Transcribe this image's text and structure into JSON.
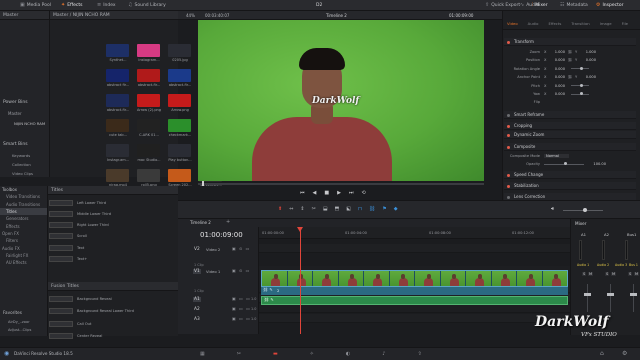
{
  "topbar": {
    "media_pool": "Media Pool",
    "effects": "Effects",
    "index": "Index",
    "sound_library": "Sound Library",
    "project_title": "D2",
    "quick_export": "Quick Export",
    "audio": "Audio",
    "mixer": "Mixer",
    "metadata": "Metadata",
    "inspector": "Inspector"
  },
  "media": {
    "master_label": "Master",
    "breadcrumb": "Master / NIJIN NCHO RAM",
    "thumbs": [
      {
        "label": "Synthet...",
        "color": "#1d2f66"
      },
      {
        "label": "Instagram...",
        "color": "#d63a83"
      },
      {
        "label": "0205.jpg",
        "color": "#2a2c34"
      },
      {
        "label": "240839.jpg",
        "color": "#1f2c6b"
      },
      {
        "label": "abstract fir...",
        "color": "#15246a"
      },
      {
        "label": "abstract-fir...",
        "color": "#b01a1a"
      },
      {
        "label": "abstract-fir...",
        "color": "#1b3a8a"
      },
      {
        "label": "abstract-fir...",
        "color": "#152a66"
      },
      {
        "label": "abstract-fir...",
        "color": "#1d2a58"
      },
      {
        "label": "Arrow (2).png",
        "color": "#c51b1b"
      },
      {
        "label": "Arrow.png",
        "color": "#c51b1b"
      },
      {
        "label": "Audio.00101...",
        "color": "#1c3a1c"
      },
      {
        "label": "cute tab...",
        "color": "#3b2a1a"
      },
      {
        "label": "C-ARK 01...",
        "color": "#222"
      },
      {
        "label": "checkmark...",
        "color": "#2b8f2b"
      },
      {
        "label": "grunge-be...",
        "color": "#4a4a4a"
      },
      {
        "label": "Instagr.am...",
        "color": "#2a2c34"
      },
      {
        "label": "mac Studio...",
        "color": "#202020"
      },
      {
        "label": "Play button...",
        "color": "#2a2c34"
      },
      {
        "label": "Play button...",
        "color": "#1d3d7a"
      },
      {
        "label": "nirag.mp4",
        "color": "#4a3a2a"
      },
      {
        "label": "roll5.png",
        "color": "#3a3a3a"
      },
      {
        "label": "Screen 202...",
        "color": "#c55a1a"
      },
      {
        "label": "ScreenRec...",
        "color": "#2a2a2a"
      }
    ],
    "power_bins": "Power Bins",
    "pb_master": "Master",
    "pb_item": "NIJIN NCHO RAM",
    "smart_bins": "Smart Bins",
    "sb_items": [
      "Keywords",
      "Collection",
      "Video Clips"
    ]
  },
  "toolbox": {
    "items": [
      "Toolbox",
      "Video Transitions",
      "Audio Transitions",
      "Titles",
      "Generators",
      "Effects",
      "Open FX",
      "Filters",
      "Audio FX",
      "Fairlight FX",
      "AU Effects"
    ],
    "favorites": "Favorites",
    "fav_items": [
      "AirDy_..zoor",
      "Adjust...Clips"
    ],
    "titles_header": "Titles",
    "titles": [
      "Left Lower Third",
      "Middle Lower Third",
      "Right Lower Third",
      "Scroll",
      "Text",
      "Text+"
    ],
    "fusion_header": "Fusion Titles",
    "fusion": [
      "Background Reveal",
      "Background Reveal Lower Third",
      "Call Out",
      "Center Reveal"
    ]
  },
  "viewer": {
    "zoom": "44%",
    "source_tc": "00:03:40:07",
    "timeline_name": "Timeline 2",
    "record_tc": "01:00:09:00",
    "watermark": "DarkWolf"
  },
  "timeline": {
    "tab_name": "Timeline 2",
    "timecode": "01:00:09:00",
    "ruler": [
      "01:00:00:00",
      "01:00:04:00",
      "01:00:08:00",
      "01:00:12:00"
    ],
    "tracks": [
      {
        "id": "V2",
        "name": "Video 2",
        "clips": ""
      },
      {
        "id": "V1",
        "name": "Video 1",
        "clips": "1 Clip"
      },
      {
        "id": "A1",
        "name": "",
        "clips": "1 Clip"
      },
      {
        "id": "A2",
        "name": "",
        "clips": ""
      },
      {
        "id": "A3",
        "name": "",
        "clips": ""
      }
    ],
    "clip_label": "2",
    "audio_gain": "1.0"
  },
  "inspector": {
    "tabs": [
      "Video",
      "Audio",
      "Effects",
      "Transition",
      "Image",
      "File"
    ],
    "transform": "Transform",
    "rows": [
      {
        "label": "Zoom",
        "x": "1.000",
        "y": "1.000"
      },
      {
        "label": "Position",
        "x": "0.000",
        "y": "0.000"
      },
      {
        "label": "Rotation Angle",
        "x": "0.000",
        "y": ""
      },
      {
        "label": "Anchor Point",
        "x": "0.000",
        "y": "0.000"
      },
      {
        "label": "Pitch",
        "x": "0.000",
        "y": ""
      },
      {
        "label": "Yaw",
        "x": "0.000",
        "y": ""
      },
      {
        "label": "Flip",
        "x": "",
        "y": ""
      }
    ],
    "sections": [
      "Smart Reframe",
      "Cropping",
      "Dynamic Zoom",
      "Composite",
      "Speed Change",
      "Stabilization",
      "Lens Correction"
    ],
    "composite_mode_label": "Composite Mode",
    "composite_mode": "Normal",
    "opacity_label": "Opacity",
    "opacity": "100.00"
  },
  "mixer": {
    "title": "Mixer",
    "channels": [
      "A1",
      "A2",
      "Bus1"
    ],
    "buttons": [
      "Audio 1",
      "Audio 2",
      "Audio 3",
      "Bus 1"
    ],
    "watermark": "DarkWolf",
    "subtitle": "VFx STUDIO"
  },
  "footer": {
    "app": "DaVinci Resolve Studio 18.5"
  },
  "colors": {
    "accent": "#e8742a",
    "playhead": "#e0453a",
    "video_clip": "#2f6f8a",
    "audio_clip": "#2c8a4a",
    "green_screen": "#5caa3a"
  }
}
